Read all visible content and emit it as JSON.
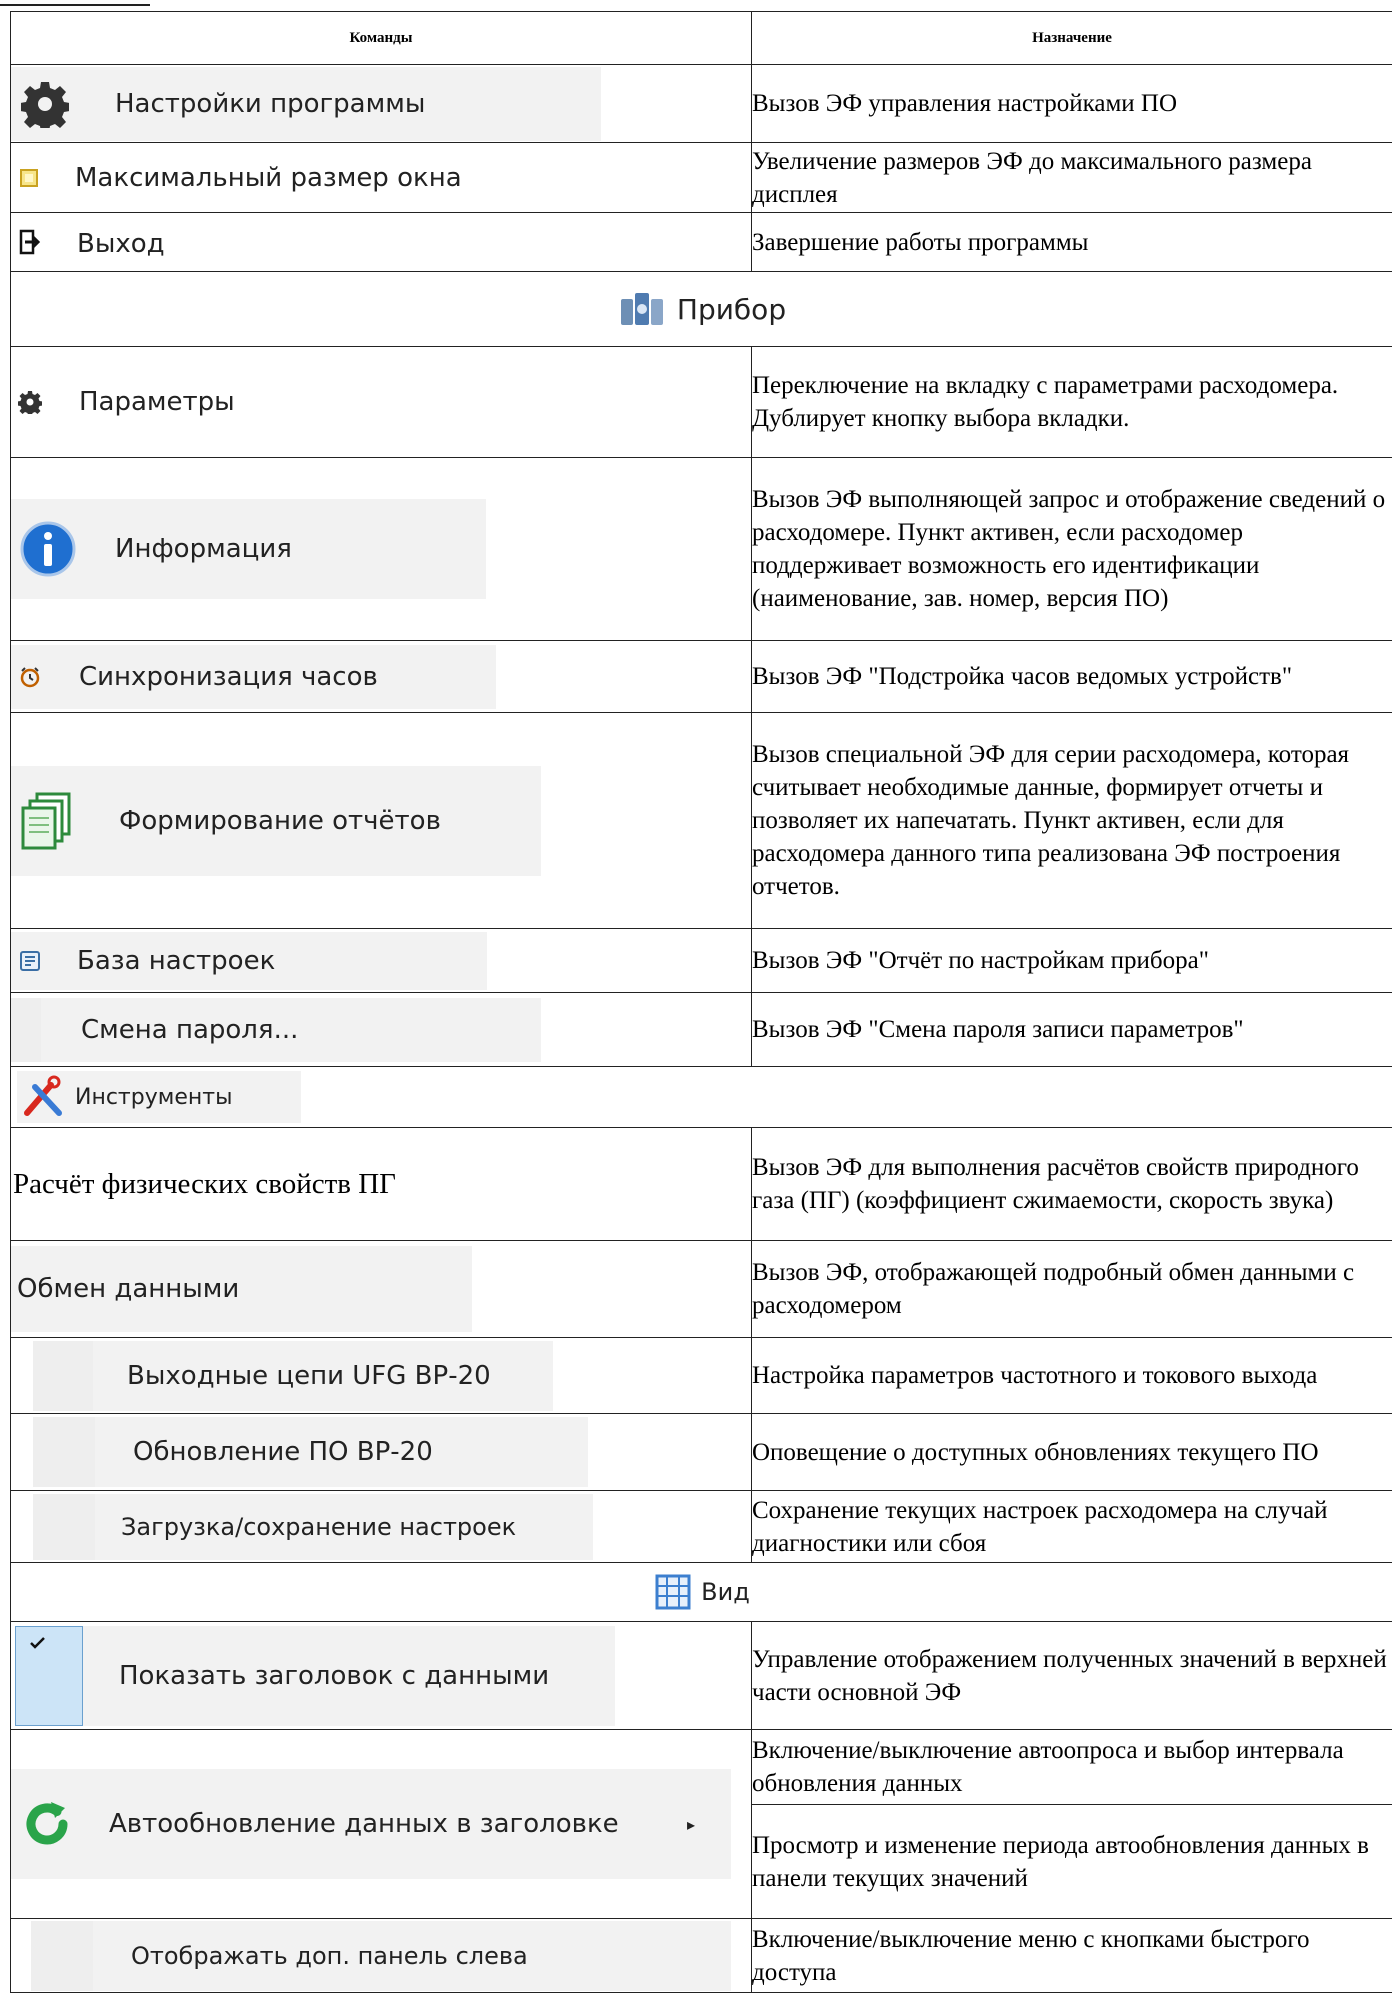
{
  "header": {
    "col_commands": "Команды",
    "col_purpose": "Назначение"
  },
  "rows_top": [
    {
      "label": "Настройки программы",
      "icon": "gear-icon",
      "desc": "Вызов ЭФ управления настройками ПО"
    },
    {
      "label": "Максимальный размер окна",
      "icon": "maximize-icon",
      "desc": "Увеличение размеров ЭФ до максимального размера дисплея"
    },
    {
      "label": "Выход",
      "icon": "exit-icon",
      "desc": "Завершение работы программы"
    }
  ],
  "section_device": {
    "label": "Прибор",
    "icon": "device-icon"
  },
  "rows_device": [
    {
      "label": "Параметры",
      "icon": "gear-small-icon",
      "desc": "Переключение на вкладку с параметрами расходомера. Дублирует кнопку выбора вкладки."
    },
    {
      "label": "Информация",
      "icon": "info-icon",
      "desc": "Вызов ЭФ выполняющей запрос и отображение сведений о расходомере. Пункт активен, если расходомер поддерживает возможность его идентификации (наименование, зав. номер, версия ПО)"
    },
    {
      "label": "Синхронизация часов",
      "icon": "clock-sync-icon",
      "desc": "Вызов ЭФ \"Подстройка часов ведомых устройств\""
    },
    {
      "label": "Формирование отчётов",
      "icon": "reports-icon",
      "desc": "Вызов специальной ЭФ для серии расходомера, которая считывает необходимые данные, формирует отчеты и позволяет их напечатать. Пункт активен, если для расходомера данного типа реализована ЭФ построения отчетов."
    },
    {
      "label": "База настроек",
      "icon": "settings-db-icon",
      "desc": "Вызов ЭФ \"Отчёт по настройкам прибора\""
    },
    {
      "label": "Смена пароля...",
      "icon": "",
      "desc": "Вызов ЭФ \"Смена пароля записи параметров\""
    }
  ],
  "section_tools": {
    "label": "Инструменты",
    "icon": "tools-icon"
  },
  "rows_tools": [
    {
      "label": "Расчёт физических свойств ПГ",
      "desc": "Вызов ЭФ для выполнения расчётов свойств природного газа (ПГ) (коэффициент сжимаемости, скорость звука)"
    },
    {
      "label": "Обмен данными",
      "desc": "Вызов ЭФ, отображающей подробный обмен данными с расходомером"
    },
    {
      "label": "Выходные цепи UFG ВР-20",
      "desc": "Настройка параметров частотного и токового выхода"
    },
    {
      "label": "Обновление ПО ВР-20",
      "desc": "Оповещение о доступных обновлениях текущего ПО"
    },
    {
      "label": "Загрузка/сохранение настроек",
      "desc": "Сохранение текущих настроек расходомера на случай диагностики или сбоя"
    }
  ],
  "section_view": {
    "label": "Вид",
    "icon": "view-grid-icon"
  },
  "rows_view": [
    {
      "label": "Показать заголовок с данными",
      "icon": "checkmark-icon",
      "desc": "Управление отображением полученных значений в верхней части основной ЭФ"
    },
    {
      "label": "Автообновление данных в заголовке",
      "icon": "refresh-icon",
      "submenu": "▸",
      "desc_a": "Включение/выключение автоопроса и выбор интервала обновления данных",
      "desc_b": "Просмотр и изменение периода автообновления данных в панели текущих значений"
    },
    {
      "label": "Отображать доп. панель слева",
      "desc": "Включение/выключение меню с кнопками быстрого доступа"
    }
  ],
  "colors": {
    "border": "#222222",
    "menu_strip": "#f2f2f2",
    "check_bg": "#cce4f7",
    "refresh_green": "#2aa44a",
    "info_blue": "#1f6fd0"
  }
}
